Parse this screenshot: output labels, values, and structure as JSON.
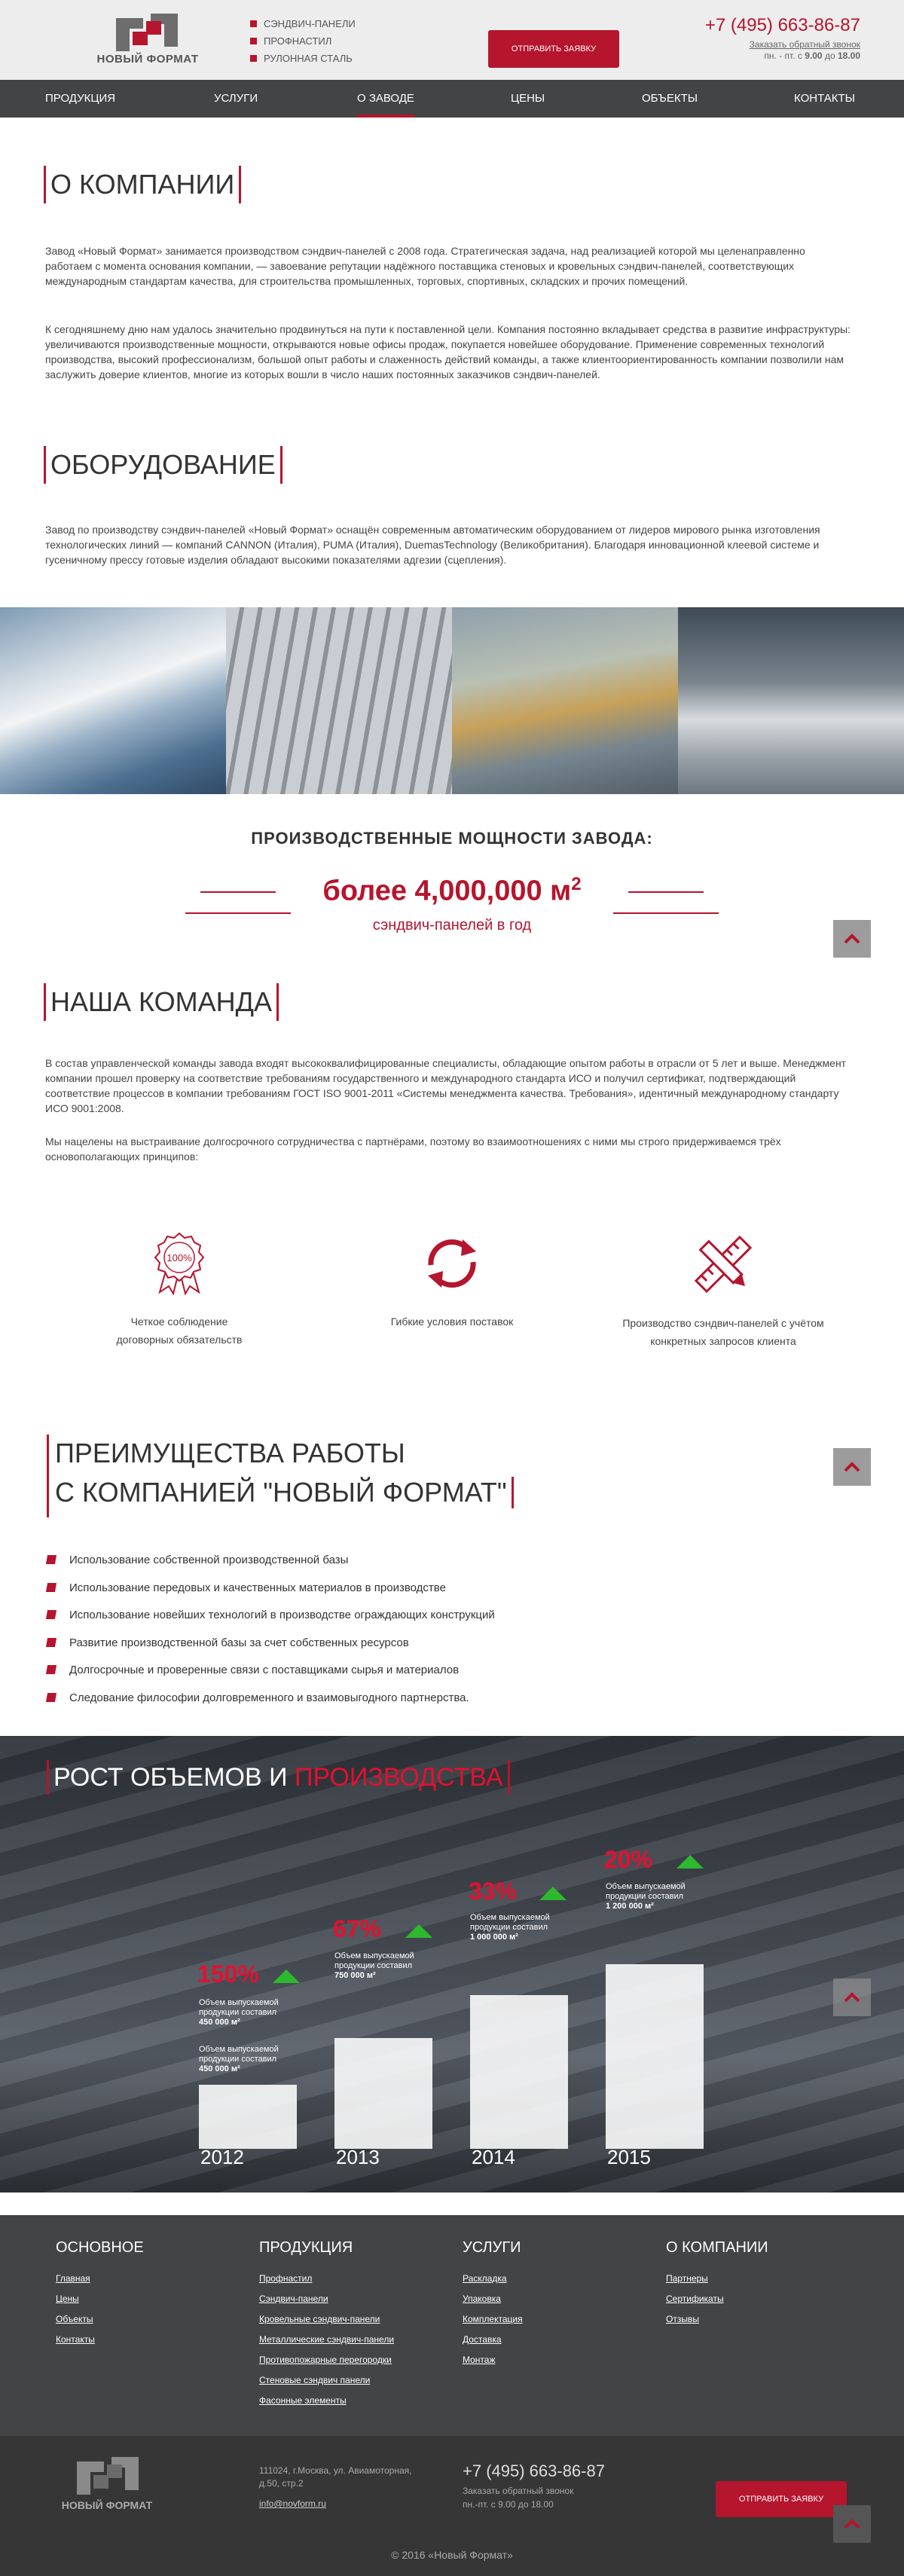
{
  "header": {
    "logo_text": "НОВЫЙ ФОРМАТ",
    "top_links": [
      "СЭНДВИЧ-ПАНЕЛИ",
      "ПРОФНАСТИЛ",
      "РУЛОННАЯ СТАЛЬ"
    ],
    "request_button": "ОТПРАВИТЬ ЗАЯВКУ",
    "phone_prefix": "+7 (495)",
    "phone_number": "663-86-87",
    "callback_label": "Заказать обратный звонок",
    "hours_prefix": "пн. - пт. с",
    "hours_from": "9.00",
    "hours_mid": "до",
    "hours_to": "18.00"
  },
  "nav": {
    "items": [
      "ПРОДУКЦИЯ",
      "УСЛУГИ",
      "О ЗАВОДЕ",
      "ЦЕНЫ",
      "ОБЪЕКТЫ",
      "КОНТАКТЫ"
    ],
    "active": "О ЗАВОДЕ"
  },
  "about": {
    "title": "О КОМПАНИИ",
    "p1": "Завод «Новый Формат» занимается производством сэндвич-панелей с 2008 года. Стратегическая задача, над реализацией которой мы целенаправленно работаем с момента основания компании, — завоевание репутации надёжного поставщика стеновых и кровельных сэндвич-панелей, соответствующих международным стандартам качества, для строительства промышленных, торговых, спортивных, складских и прочих помещений.",
    "p2": "К сегодняшнему дню нам удалось значительно продвинуться на пути к поставленной цели. Компания постоянно вкладывает средства в развитие инфраструктуры: увеличиваются производственные мощности, открываются новые офисы продаж, покупается новейшее оборудование. Применение современных технологий производства, высокий профессионализм, большой опыт работы и слаженность действий команды, а также клиентоориентированность компании позволили нам заслужить доверие клиентов, многие из которых вошли в число наших постоянных заказчиков сэндвич-панелей."
  },
  "equipment": {
    "title": "ОБОРУДОВАНИЕ",
    "p1": "Завод по производству сэндвич-панелей «Новый Формат» оснащён современным автоматическим оборудованием от лидеров мирового рынка изготовления технологических линий — компаний CANNON (Италия), PUMA (Италия), DuemasTechnology (Великобритания). Благодаря инновационной клеевой системе и гусеничному прессу готовые изделия обладают высокими показателями адгезии (сцепления)."
  },
  "capacity": {
    "title": "ПРОИЗВОДСТВЕННЫЕ МОЩНОСТИ ЗАВОДА:",
    "value": "более 4,000,000 м",
    "sup": "2",
    "sub": "сэндвич-панелей в год"
  },
  "team": {
    "title": "НАША КОМАНДА",
    "p1": "В состав управленческой команды завода входят высококвалифицированные специалисты, обладающие опытом работы в отрасли от 5 лет и выше. Менеджмент компании прошел проверку на соответствие требованиям государственного и международного стандарта ИСО и получил сертификат, подтверждающий соответствие процессов в компании требованиям ГОСТ ISO 9001-2011 «Системы менеджмента качества. Требования», идентичный международному стандарту ИСО 9001:2008.",
    "p2": "Мы нацелены на выстраивание долгосрочного сотрудничества с партнёрами, поэтому во взаимоотношениях с ними мы строго придерживаемся трёх основополагающих принципов:",
    "principles": [
      {
        "icon": "medal-icon",
        "badge": "100%",
        "label": "Четкое соблюдение договорных обязательств"
      },
      {
        "icon": "exchange-arrows-icon",
        "label": "Гибкие условия поставок"
      },
      {
        "icon": "ruler-pencil-icon",
        "label": "Производство сэндвич-панелей с учётом конкретных запросов клиента"
      }
    ]
  },
  "advantages": {
    "title_line1": "ПРЕИМУЩЕСТВА РАБОТЫ",
    "title_line2": "С КОМПАНИЕЙ \"НОВЫЙ ФОРМАТ\"",
    "items": [
      "Использование собственной производственной базы",
      "Использование передовых и качественных материалов в производстве",
      "Использование новейших технологий в производстве ограждающих конструкций",
      "Развитие производственной базы за счет собственных ресурсов",
      "Долгосрочные и проверенные связи с поставщиками сырья и материалов",
      "Следование философии долговременного и взаимовыгодного партнерства."
    ]
  },
  "growth": {
    "title_white": "РОСТ ОБЪЕМОВ И",
    "title_red": "ПРОИЗВОДСТВА",
    "caption": "Объем выпускаемой продукции составил",
    "bars": [
      {
        "year": "2012",
        "pct": "150%",
        "volume": "450 000 м²",
        "prev_volume": "450 000 м²",
        "level": 0.16
      },
      {
        "year": "2013",
        "pct": "67%",
        "volume": "750 000 м²",
        "level": 0.23
      },
      {
        "year": "2014",
        "pct": "33%",
        "volume": "1 000 000 м²",
        "level": 0.3
      },
      {
        "year": "2015",
        "pct": "20%",
        "volume": "1 200 000 м²",
        "level": 0.36
      }
    ]
  },
  "footer": {
    "cols": [
      {
        "title": "ОСНОВНОЕ",
        "links": [
          "Главная",
          "Цены",
          "Объекты",
          "Контакты"
        ]
      },
      {
        "title": "ПРОДУКЦИЯ",
        "links": [
          "Профнастил",
          "Сэндвич-панели",
          "Кровельные сэндвич-панели",
          "Металлические сэндвич-панели",
          "Противопожарные перегородки",
          "Стеновые сэндвич панели",
          "Фасонные элементы"
        ]
      },
      {
        "title": "УСЛУГИ",
        "links": [
          "Раскладка",
          "Упаковка",
          "Комплектация",
          "Доставка",
          "Монтаж"
        ]
      },
      {
        "title": "О КОМПАНИИ",
        "links": [
          "Партнеры",
          "Сертификаты",
          "Отзывы"
        ]
      }
    ],
    "address_line1": "111024, г.Москва, ул. Авиамоторная,",
    "address_line2": "д.50, стр.2",
    "email": "info@novform.ru",
    "phone": "+7 (495) 663-86-87",
    "callback_label": "Заказать обратный звонок",
    "hours": "пн.-пт. с 9.00 до 18.00",
    "request_button": "ОТПРАВИТЬ ЗАЯВКУ",
    "logo_text": "НОВЫЙ ФОРМАТ",
    "copyright": "© 2016 «Новый Формат»"
  },
  "colors": {
    "accent": "#b5152d",
    "nav_bg": "#424446",
    "growth_pct": "#e3102f",
    "growth_arrow": "#2eb82e"
  }
}
